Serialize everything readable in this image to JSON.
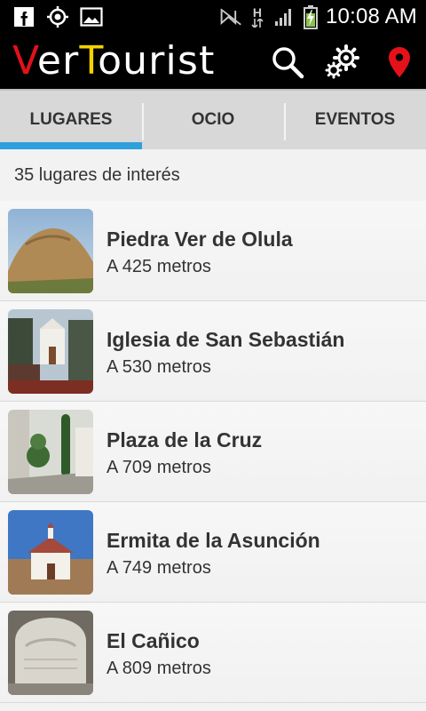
{
  "status_bar": {
    "left_icons": [
      "facebook-icon",
      "gps-icon",
      "image-icon"
    ],
    "right_icons": [
      "nfc-muted-icon",
      "network-h-icon",
      "signal-icon",
      "battery-charging-icon"
    ],
    "network_label": "H",
    "time": "10:08 AM"
  },
  "app_bar": {
    "logo": {
      "part1": "V",
      "part2": "er",
      "part3": "T",
      "part4": "ourist"
    },
    "actions": [
      "search-icon",
      "settings-icon",
      "location-pin-icon"
    ],
    "colors": {
      "logo_red": "#e4111a",
      "logo_yellow": "#f5d200",
      "pin_red": "#e4111a"
    }
  },
  "tabs": [
    {
      "label": "LUGARES",
      "active": true
    },
    {
      "label": "OCIO",
      "active": false
    },
    {
      "label": "EVENTOS",
      "active": false
    }
  ],
  "accent_color": "#2ea0dc",
  "count_text": "35 lugares de interés",
  "places": [
    {
      "title": "Piedra Ver de Olula",
      "distance": "A 425 metros"
    },
    {
      "title": "Iglesia de San Sebastián",
      "distance": "A 530 metros"
    },
    {
      "title": "Plaza de la Cruz",
      "distance": "A 709 metros"
    },
    {
      "title": "Ermita de la Asunción",
      "distance": "A 749 metros"
    },
    {
      "title": "El Cañico",
      "distance": "A 809 metros"
    }
  ]
}
